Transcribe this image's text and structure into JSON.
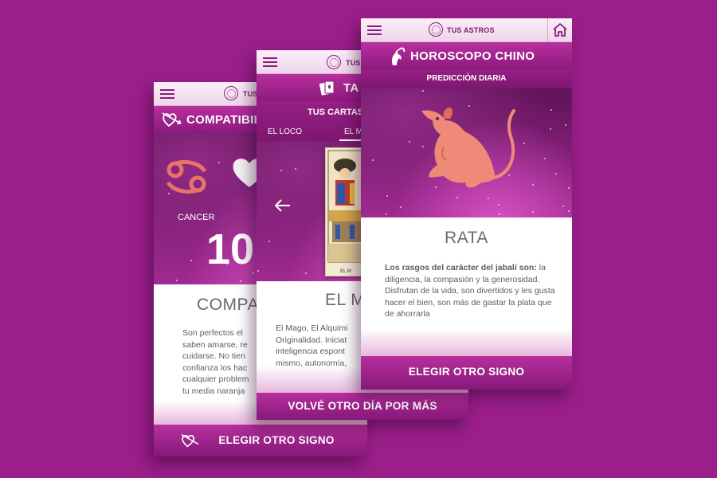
{
  "app": {
    "logo_text": "TUS ASTROS"
  },
  "phone_compat": {
    "section_title": "COMPATIBIL",
    "sign_name": "CANCER",
    "score": "10",
    "result_title": "COMPAT",
    "body_lines": [
      "Son perfectos el",
      "saben amarse, re",
      "cuidarse. No tien",
      "confianza los hac",
      "cualquier problem",
      "tu  media naranja"
    ],
    "button_label": "ELEGIR OTRO SIGNO",
    "colors": {
      "sign": "#e8736a"
    },
    "icons": [
      "menu-icon",
      "heart-arrow-icon",
      "cancer-sign-icon",
      "heart-icon"
    ]
  },
  "phone_tarot": {
    "section_title": "TA",
    "sub_title": "TUS CARTAS",
    "tabs": [
      "EL LOCO",
      "EL M"
    ],
    "card_caption": "EL M",
    "result_title": "EL M",
    "body_lines": [
      "El Mago, El Alquimi",
      "Originalidad. Iniciat",
      "inteligencia espont",
      "mismo, autonomía,"
    ],
    "button_label": "VOLVÉ OTRO DÍA POR MÁS",
    "icons": [
      "menu-icon",
      "tarot-cards-icon",
      "arrow-left-icon"
    ]
  },
  "phone_chinese": {
    "section_title": "HOROSCOPO CHINO",
    "sub_title": "PREDICCIÓN DIARIA",
    "sign_name": "RATA",
    "body_bold": "Los rasgos del carácter del jabalí son:",
    "body_text": " la diligencia, la compasión y la generosidad. Disfrutan de la vida, son divertidos y les gusta hacer el bien, son más de gastar la plata que de ahorrarla",
    "button_label": "ELEGIR OTRO SIGNO",
    "colors": {
      "rat": "#ef8a78"
    },
    "icons": [
      "menu-icon",
      "home-icon",
      "goat-icon",
      "rat-icon"
    ]
  }
}
